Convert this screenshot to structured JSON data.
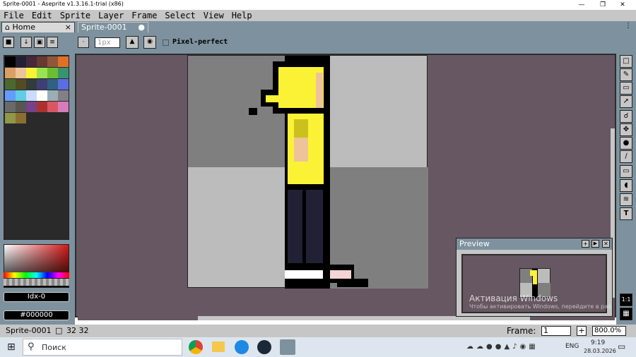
{
  "window": {
    "title": "Sprite-0001 - Aseprite v1.3.16.1-trial (x86)"
  },
  "menu": [
    "File",
    "Edit",
    "Sprite",
    "Layer",
    "Frame",
    "Select",
    "View",
    "Help"
  ],
  "tabs": {
    "home": "Home",
    "sprite": "Sprite-0001",
    "home_close": "×"
  },
  "toolbar": {
    "size_value": "1px",
    "pixel_perfect_label": "Pixel-perfect"
  },
  "colors": {
    "bg_panel": "#7d929e",
    "canvas_bg": "#665762",
    "sprite_bg": "#bcbcbc",
    "yellow": "#fbf236",
    "black": "#000000"
  },
  "palette_colors": [
    "#000000",
    "#222034",
    "#45283c",
    "#663931",
    "#8f563b",
    "#df7126",
    "#d9a066",
    "#eec39a",
    "#fbf236",
    "#99e550",
    "#6abe30",
    "#37946e",
    "#4b692f",
    "#524b24",
    "#323c39",
    "#3f3f74",
    "#306082",
    "#5b6ee1",
    "#639bff",
    "#5fcde4",
    "#cbdbfc",
    "#ffffff",
    "#9badb7",
    "#847e87",
    "#696a6a",
    "#595652",
    "#76428a",
    "#ac3232",
    "#d95763",
    "#d77bba",
    "#8f974a",
    "#8a6f30"
  ],
  "color_bar": {
    "index_label": "Idx-0",
    "hex_label": "#000000"
  },
  "preview": {
    "title": "Preview"
  },
  "watermark": {
    "line1": "Активация Windows",
    "line2": "Чтобы активировать Windows, перейдите в раздел \"Параметры\"."
  },
  "status": {
    "sprite_name": "Sprite-0001",
    "size": "32 32",
    "frame_label": "Frame:",
    "frame_value": "1",
    "zoom": "800.0%"
  },
  "taskbar": {
    "search_placeholder": "Поиск",
    "lang": "ENG",
    "time": "9:19",
    "date": "28.03.2026"
  }
}
